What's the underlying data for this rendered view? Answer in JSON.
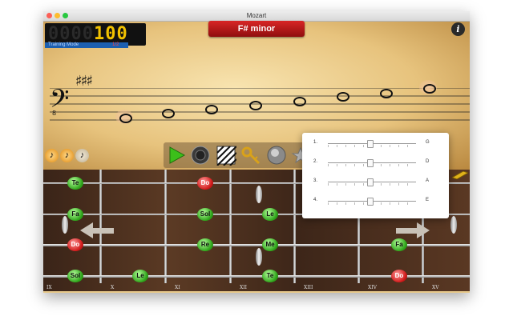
{
  "window": {
    "title": "Mozart"
  },
  "score": {
    "dim_digits": "0000",
    "lit_digits": "100",
    "mode": "Training Mode",
    "ratio": "1/2"
  },
  "banner": {
    "key": "F# minor"
  },
  "info": {
    "label": "i"
  },
  "colors": {
    "accent_red": "#c81a1a",
    "note_green": "#2fa51b",
    "mode_blue": "#1c5fb0",
    "digit_yellow": "#f2c200"
  },
  "popup": {
    "rows": [
      {
        "num": "1.",
        "string": "G",
        "level": 0.48
      },
      {
        "num": "2.",
        "string": "D",
        "level": 0.48
      },
      {
        "num": "3.",
        "string": "A",
        "level": 0.48
      },
      {
        "num": "4.",
        "string": "E",
        "level": 0.48
      }
    ]
  },
  "fretboard": {
    "roman": [
      "IX",
      "X",
      "XI",
      "XII",
      "XIII",
      "XIV",
      "XV"
    ],
    "notes": [
      {
        "label": "Te",
        "color": "green"
      },
      {
        "label": "Do",
        "color": "red"
      },
      {
        "label": "Fa",
        "color": "green"
      },
      {
        "label": "Sol",
        "color": "green"
      },
      {
        "label": "Le",
        "color": "green"
      },
      {
        "label": "Do",
        "color": "red"
      },
      {
        "label": "Re",
        "color": "green"
      },
      {
        "label": "Me",
        "color": "green"
      },
      {
        "label": "Fa",
        "color": "green"
      },
      {
        "label": "Sol",
        "color": "green"
      },
      {
        "label": "Le",
        "color": "green"
      },
      {
        "label": "Te",
        "color": "green"
      },
      {
        "label": "Do",
        "color": "red"
      }
    ]
  }
}
